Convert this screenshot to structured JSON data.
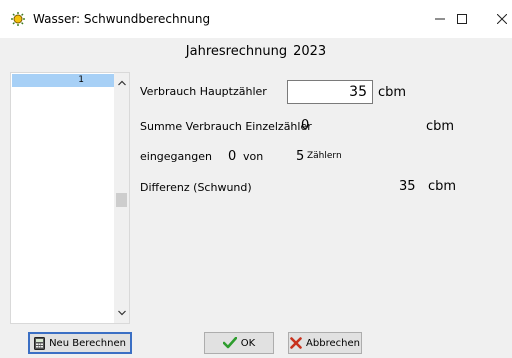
{
  "window": {
    "title": "Wasser: Schwundberechnung",
    "icon": "sun-icon"
  },
  "header": {
    "label": "Jahresrechnung",
    "year": "2023"
  },
  "list": {
    "items": [
      "1"
    ]
  },
  "form": {
    "verbrauch_label": "Verbrauch Hauptzähler",
    "verbrauch_value": "35",
    "verbrauch_unit": "cbm",
    "summe_label": "Summe Verbrauch Einzelzähler",
    "summe_value": "0",
    "summe_unit": "cbm",
    "eingegangen_label": "eingegangen",
    "eingegangen_value": "0",
    "von_label": "von",
    "total_count": "5",
    "zaehler_label": "Zählern",
    "differenz_label": "Differenz (Schwund)",
    "differenz_value": "35",
    "differenz_unit": "cbm"
  },
  "buttons": {
    "neu_berechnen": "Neu Berechnen",
    "ok": "OK",
    "abbrechen": "Abbrechen"
  },
  "colors": {
    "selection": "#a7d0f6",
    "ok_check": "#2e9d2e",
    "cancel_x": "#c8321e",
    "focus_border": "#3b6fc4"
  }
}
